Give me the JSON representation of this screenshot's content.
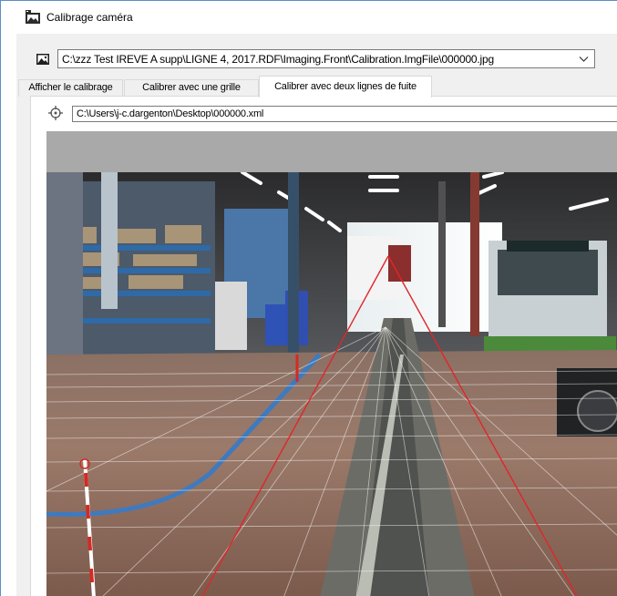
{
  "window": {
    "title": "Calibrage caméra",
    "title_icon": "camera-calibration-icon"
  },
  "image_path": {
    "icon": "image-icon",
    "value": "C:\\zzz Test IREVE A supp\\LIGNE 4, 2017.RDF\\Imaging.Front\\Calibration.ImgFile\\000000.jpg",
    "dropdown_icon": "chevron-down-icon"
  },
  "tabs": [
    {
      "label": "Afficher le calibrage",
      "active": false
    },
    {
      "label": "Calibrer avec une grille",
      "active": false
    },
    {
      "label": "Calibrer avec deux lignes de fuite",
      "active": true
    }
  ],
  "calibration_file": {
    "icon": "target-icon",
    "value": "C:\\Users\\j-c.dargenton\\Desktop\\000000.xml"
  },
  "viewer": {
    "content": "garage-camera-image",
    "vanishing_lines_color": "#e0262a",
    "grid_color": "#ffffff"
  }
}
